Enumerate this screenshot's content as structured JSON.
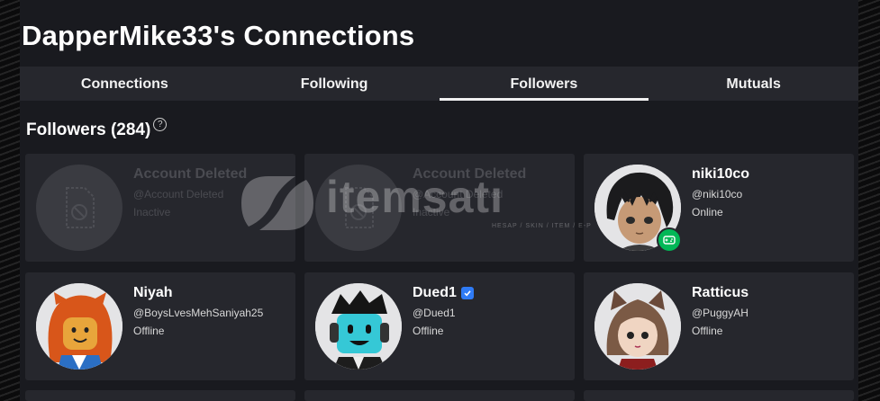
{
  "page": {
    "title": "DapperMike33's Connections"
  },
  "tabs": [
    {
      "label": "Connections"
    },
    {
      "label": "Following"
    },
    {
      "label": "Followers"
    },
    {
      "label": "Mutuals"
    }
  ],
  "section": {
    "title": "Followers (284)",
    "help_symbol": "?"
  },
  "cards": [
    {
      "name": "Account Deleted",
      "handle": "@Account Deleted",
      "status": "Inactive"
    },
    {
      "name": "Account Deleted",
      "handle": "@Account Deleted",
      "status": "Inactive"
    },
    {
      "name": "niki10co",
      "handle": "@niki10co",
      "status": "Online"
    },
    {
      "name": "Niyah",
      "handle": "@BoysLvesMehSaniyah25",
      "status": "Offline"
    },
    {
      "name": "Dued1",
      "handle": "@Dued1",
      "status": "Offline"
    },
    {
      "name": "Ratticus",
      "handle": "@PuggyAH",
      "status": "Offline"
    }
  ],
  "watermark": {
    "text": "itemsatı",
    "subtext": "HESAP / SKIN / ITEM / E-P"
  },
  "colors": {
    "background": "#191a1f",
    "card": "#26272d",
    "online_badge": "#02b757",
    "verified": "#2f7bf5"
  }
}
